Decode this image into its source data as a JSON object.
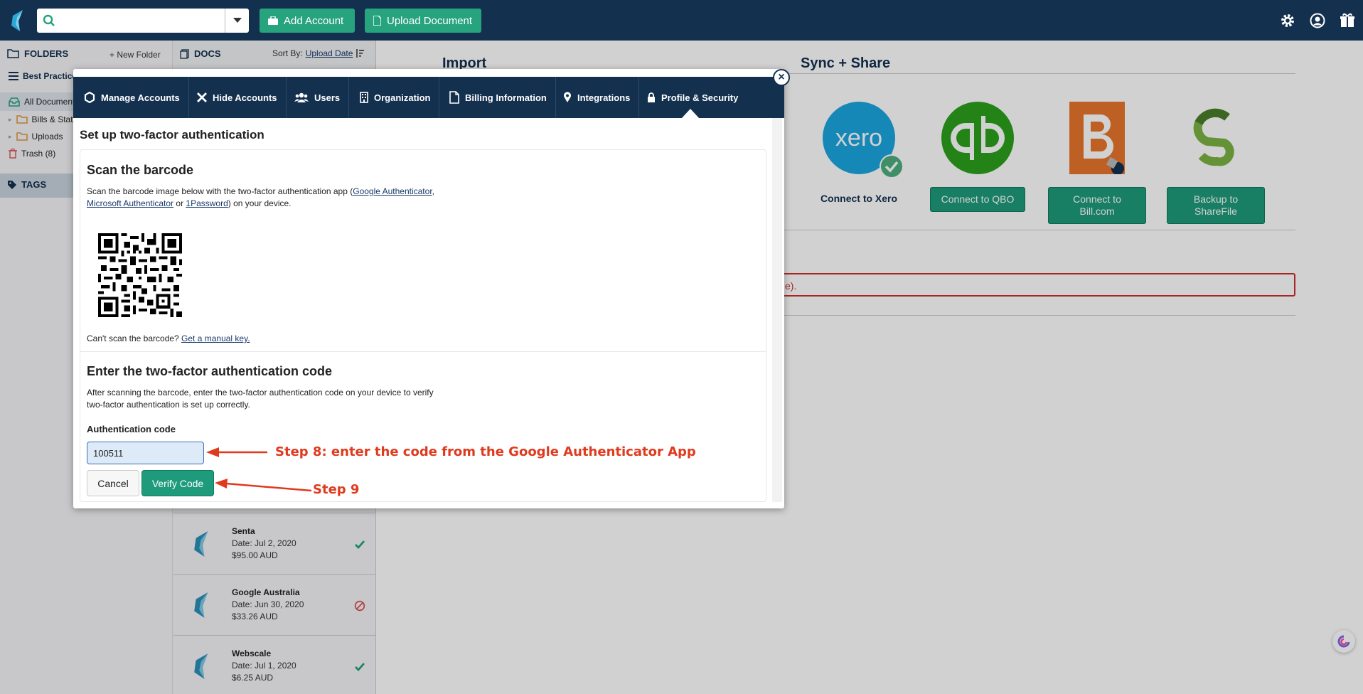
{
  "topbar": {
    "add_account": "Add Account",
    "upload_document": "Upload Document"
  },
  "sidebar": {
    "folders_title": "FOLDERS",
    "new_folder": "+ New Folder",
    "workspace": "Best Practice Bookkeeping",
    "items": [
      {
        "label": "All Documents"
      },
      {
        "label": "Bills & Statements"
      },
      {
        "label": "Uploads"
      },
      {
        "label": "Trash (8)"
      }
    ],
    "tags_title": "TAGS"
  },
  "docs": {
    "title": "DOCS",
    "sort_label": "Sort By:",
    "sort_value": "Upload Date",
    "items": [
      {
        "name": "Senta",
        "date": "Date: Jul 2, 2020",
        "amount": "$95.00 AUD",
        "status": "check"
      },
      {
        "name": "Google Australia",
        "date": "Date: Jun 30, 2020",
        "amount": "$33.26 AUD",
        "status": "blocked"
      },
      {
        "name": "Webscale",
        "date": "Date: Jul 1, 2020",
        "amount": "$6.25 AUD",
        "status": "check"
      }
    ]
  },
  "main": {
    "import_title": "Import",
    "sync_title": "Sync + Share",
    "xero_logo_text": "xero",
    "connect_xero": "Connect to Xero",
    "connect_qbo": "Connect to QBO",
    "connect_bill_line1": "Connect to",
    "connect_bill_line2": "Bill.com",
    "backup_sharefile_line1": "Backup to",
    "backup_sharefile_line2": "ShareFile",
    "alert_fragment": "e)."
  },
  "modal": {
    "tabs": [
      {
        "label": "Manage Accounts"
      },
      {
        "label": "Hide Accounts"
      },
      {
        "label": "Users"
      },
      {
        "label": "Organization"
      },
      {
        "label": "Billing Information"
      },
      {
        "label": "Integrations"
      },
      {
        "label": "Profile & Security"
      }
    ],
    "close": "×",
    "title": "Set up two-factor authentication",
    "scan": {
      "heading": "Scan the barcode",
      "text_before": "Scan the barcode image below with the two-factor authentication app (",
      "link_google": "Google Authenticator",
      "comma": ",",
      "link_microsoft": "Microsoft Authenticator",
      "or": " or ",
      "link_1password": "1Password",
      "text_after": ") on your device.",
      "cant_scan": "Can't scan the barcode? ",
      "manual_key": "Get a manual key."
    },
    "enter": {
      "heading": "Enter the two-factor authentication code",
      "text_line1": "After scanning the barcode, enter the two-factor authentication code on your device to verify",
      "text_line2": "two-factor authentication is set up correctly.",
      "code_label": "Authentication code",
      "code_value": "100511",
      "cancel": "Cancel",
      "verify": "Verify Code"
    }
  },
  "annotations": {
    "step8": "Step 8: enter the code from the Google Authenticator App",
    "step9": "Step 9"
  },
  "colors": {
    "navy": "#13304f",
    "green": "#1e9b7b",
    "annotation_red": "#e03a1e"
  }
}
